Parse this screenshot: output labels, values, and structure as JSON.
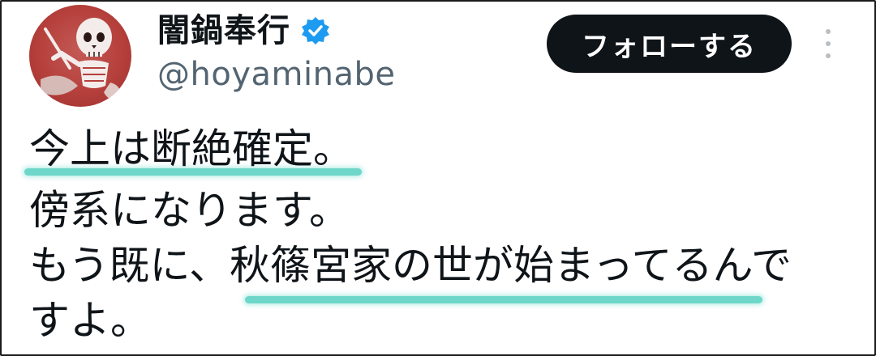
{
  "user": {
    "display_name": "闇鍋奉行",
    "handle": "@hoyaminabe",
    "avatar_icon": "skeleton-avatar-icon",
    "verified_icon": "verified-badge-icon",
    "verified_color": "#1d9bf0"
  },
  "actions": {
    "follow_label": "フォローする",
    "more_icon": "more-vertical-icon"
  },
  "tweet": {
    "lines": [
      "今上は断絶確定。",
      "傍系になります。",
      "もう既に、秋篠宮家の世が始まってるんで",
      "すよ。"
    ]
  },
  "colors": {
    "text": "#0f1419",
    "secondary_text": "#536471",
    "button_bg": "#0f1419",
    "button_text": "#ffffff",
    "highlight": "#5fd3c4",
    "avatar_bg": "#b5403c"
  }
}
